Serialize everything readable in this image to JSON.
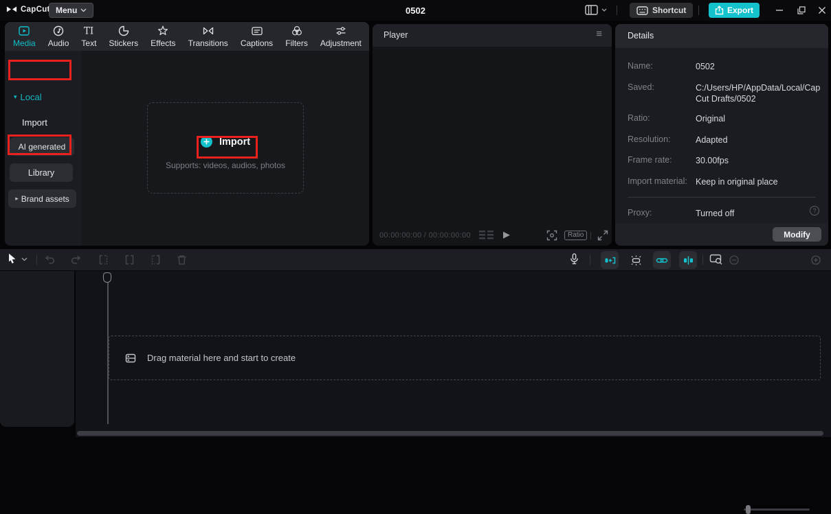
{
  "titlebar": {
    "app_name": "CapCut",
    "menu_label": "Menu",
    "project_title": "0502",
    "shortcut_label": "Shortcut",
    "export_label": "Export"
  },
  "media_panel": {
    "tabs": [
      {
        "label": "Media",
        "active": true
      },
      {
        "label": "Audio"
      },
      {
        "label": "Text"
      },
      {
        "label": "Stickers"
      },
      {
        "label": "Effects"
      },
      {
        "label": "Transitions"
      },
      {
        "label": "Captions"
      },
      {
        "label": "Filters"
      },
      {
        "label": "Adjustment"
      }
    ],
    "sidebar": {
      "local_label": "Local",
      "import_label": "Import",
      "ai_generated_label": "AI generated",
      "library_label": "Library",
      "brand_assets_label": "Brand assets"
    },
    "import_area": {
      "button_label": "Import",
      "supports_text": "Supports: videos, audios, photos"
    }
  },
  "player_panel": {
    "title": "Player",
    "timecode": "00:00:00:00 / 00:00:00:00",
    "ratio_label": "Ratio"
  },
  "details_panel": {
    "title": "Details",
    "rows": [
      {
        "label": "Name:",
        "value": "0502"
      },
      {
        "label": "Saved:",
        "value": "C:/Users/HP/AppData/Local/CapCut Drafts/0502"
      },
      {
        "label": "Ratio:",
        "value": "Original"
      },
      {
        "label": "Resolution:",
        "value": "Adapted"
      },
      {
        "label": "Frame rate:",
        "value": "30.00fps"
      },
      {
        "label": "Import material:",
        "value": "Keep in original place"
      }
    ],
    "proxy_label": "Proxy:",
    "proxy_value": "Turned off",
    "modify_label": "Modify"
  },
  "timeline": {
    "drop_hint": "Drag material here and start to create"
  },
  "icons": {
    "caret_down": "▾",
    "caret_right": "▸",
    "hamburger": "≡",
    "play": "▶",
    "question": "?"
  },
  "colors": {
    "accent_teal": "#13c2cd",
    "annotation_red": "#e9221e",
    "panel_bg": "#1b1c21",
    "titlebar_bg": "#0a0a0c"
  }
}
